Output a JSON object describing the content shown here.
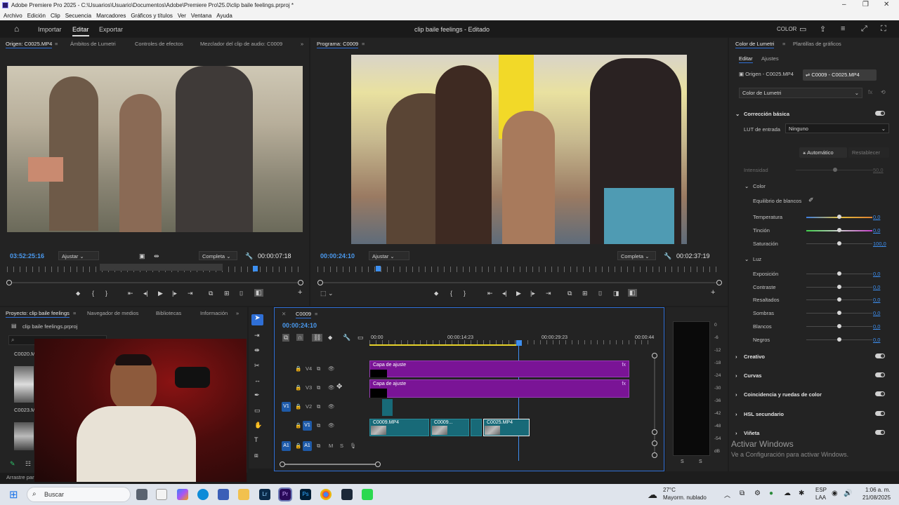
{
  "window": {
    "title": "Adobe Premiere Pro 2025 - C:\\Usuarios\\Usuario\\Documentos\\Adobe\\Premiere Pro\\25.0\\clip baile feelings.prproj *",
    "menu": [
      "Archivo",
      "Edición",
      "Clip",
      "Secuencia",
      "Marcadores",
      "Gráficos y títulos",
      "Ver",
      "Ventana",
      "Ayuda"
    ]
  },
  "header": {
    "nav": [
      "Importar",
      "Editar",
      "Exportar"
    ],
    "project_title": "clip baile feelings - Editado",
    "color_label": "COLOR"
  },
  "source": {
    "tabs": [
      "Origen: C0025.MP4",
      "Ámbitos de Lumetri",
      "Controles de efectos",
      "Mezclador del clip de audio: C0009"
    ],
    "timecode": "03:52:25:16",
    "fit": "Ajustar",
    "quality": "Completa",
    "duration": "00:00:07:18"
  },
  "program": {
    "tab": "Programa: C0009",
    "timecode": "00:00:24:10",
    "fit": "Ajustar",
    "quality": "Completa",
    "duration": "00:02:37:19"
  },
  "project": {
    "tabs": [
      "Proyecto: clip baile feelings",
      "Navegador de medios",
      "Bibliotecas",
      "Información"
    ],
    "file": "clip baile feelings.prproj",
    "items": [
      "C0020.M",
      "C0023.M"
    ],
    "status": "Arrastre para"
  },
  "timeline": {
    "seq_tab": "C0009",
    "timecode": "00:00:24:10",
    "ruler": [
      "00:00",
      "00:00:14:23",
      "00:00:29:23",
      "00:00:44"
    ],
    "tracks": [
      "V4",
      "V3",
      "V2",
      "V1",
      "A1"
    ],
    "clips": {
      "adj1": "Capa de ajuste",
      "adj2": "Capa de ajuste",
      "c1": "C0009.MP4",
      "c2": "C0009...",
      "c3": "C0025.MP4"
    },
    "meter_scale": [
      "0",
      "-6",
      "-12",
      "-18",
      "-24",
      "-30",
      "-36",
      "-42",
      "-48",
      "-54",
      "dB"
    ],
    "meter_foot": [
      "S",
      "S"
    ]
  },
  "lumetri": {
    "tabs": [
      "Color de Lumetri",
      "Plantillas de gráficos"
    ],
    "subtabs": [
      "Editar",
      "Ajustes"
    ],
    "src_btn": "Origen - C0025.MP4",
    "seq_btn": "C0009 - C0025.MP4",
    "effect": "Color de Lumetri",
    "basic": "Corrección básica",
    "lut_label": "LUT de entrada",
    "lut_value": "Ninguno",
    "auto": "Automático",
    "reset": "Restablecer",
    "intensity": "Intensidad",
    "intensity_val": "50,0",
    "color": "Color",
    "wb": "Equilibrio de blancos",
    "color_rows": [
      {
        "label": "Temperatura",
        "value": "0,0"
      },
      {
        "label": "Tinción",
        "value": "0,0"
      },
      {
        "label": "Saturación",
        "value": "100,0"
      }
    ],
    "luz": "Luz",
    "luz_rows": [
      {
        "label": "Exposición",
        "value": "0,0"
      },
      {
        "label": "Contraste",
        "value": "0,0"
      },
      {
        "label": "Resaltados",
        "value": "0,0"
      },
      {
        "label": "Sombras",
        "value": "0,0"
      },
      {
        "label": "Blancos",
        "value": "0,0"
      },
      {
        "label": "Negros",
        "value": "0,0"
      }
    ],
    "sections": [
      "Creativo",
      "Curvas",
      "Coincidencia y ruedas de color",
      "HSL secundario",
      "Viñeta"
    ],
    "watermark1": "Activar Windows",
    "watermark2": "Ve a Configuración para activar Windows."
  },
  "taskbar": {
    "search": "Buscar",
    "weather_temp": "27°C",
    "weather_desc": "Mayorm. nublado",
    "lang1": "ESP",
    "lang2": "LAA",
    "time": "1:06 a. m.",
    "date": "21/08/2025"
  },
  "colors": {
    "accent_blue": "#2f6fd6",
    "adjustment_layer": "#7a1496",
    "video_clip": "#186a78",
    "timecode": "#4a9af0"
  }
}
